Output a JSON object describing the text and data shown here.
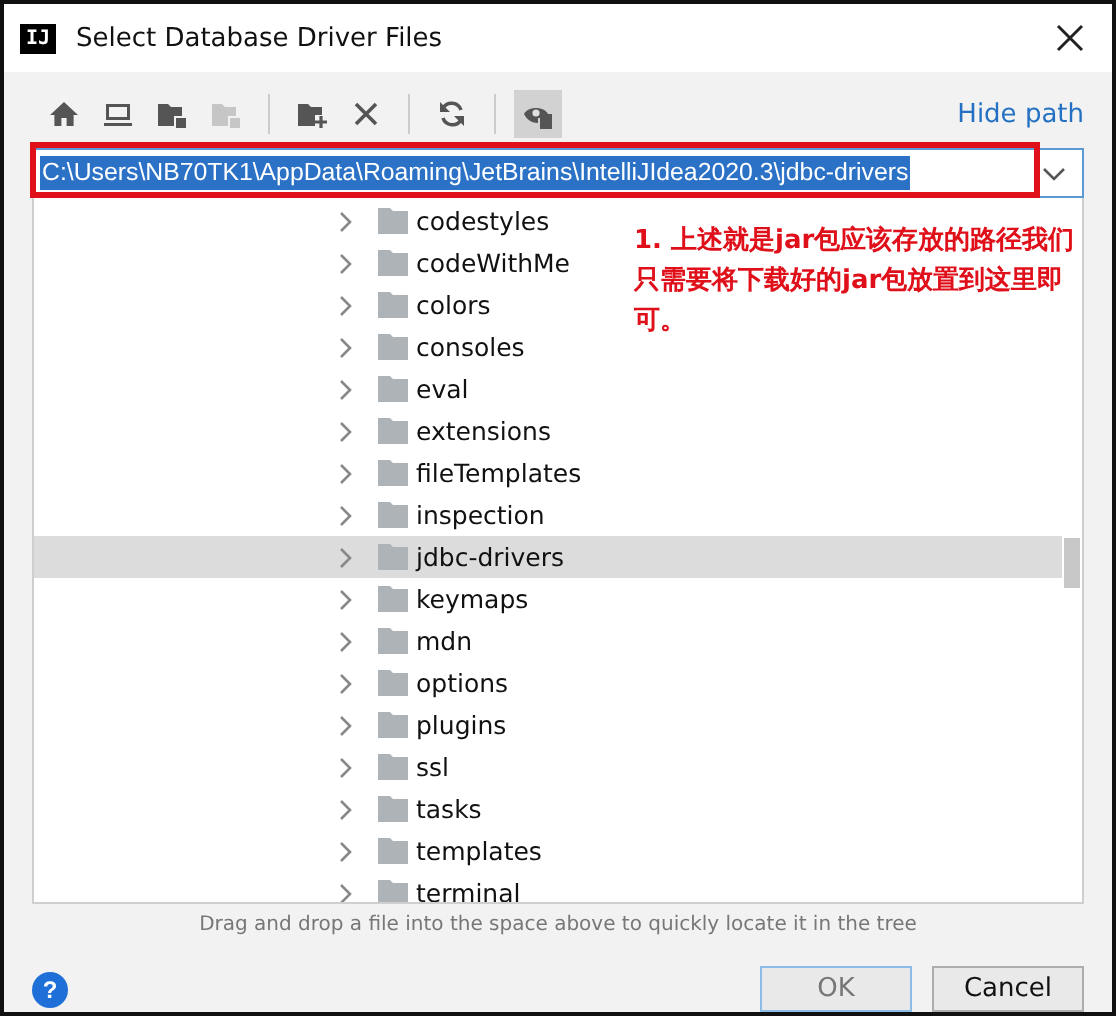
{
  "window": {
    "title": "Select Database Driver Files",
    "app_badge": "IJ"
  },
  "toolbar": [
    {
      "kind": "home",
      "disabled": false,
      "on": false
    },
    {
      "kind": "desktop",
      "disabled": false,
      "on": false
    },
    {
      "kind": "project",
      "disabled": false,
      "on": false
    },
    {
      "kind": "module",
      "disabled": true,
      "on": false
    },
    {
      "kind": "sep"
    },
    {
      "kind": "newfolder",
      "disabled": false,
      "on": false
    },
    {
      "kind": "delete",
      "disabled": false,
      "on": false
    },
    {
      "kind": "sep"
    },
    {
      "kind": "refresh",
      "disabled": false,
      "on": false
    },
    {
      "kind": "sep"
    },
    {
      "kind": "hidden",
      "disabled": false,
      "on": true
    }
  ],
  "hide_path_link": "Hide path",
  "path_field": {
    "value": "C:\\Users\\NB70TK1\\AppData\\Roaming\\JetBrains\\IntelliJIdea2020.3\\jdbc-drivers"
  },
  "tree": {
    "items": [
      {
        "name": "codestyles",
        "selected": false
      },
      {
        "name": "codeWithMe",
        "selected": false
      },
      {
        "name": "colors",
        "selected": false
      },
      {
        "name": "consoles",
        "selected": false
      },
      {
        "name": "eval",
        "selected": false
      },
      {
        "name": "extensions",
        "selected": false
      },
      {
        "name": "fileTemplates",
        "selected": false
      },
      {
        "name": "inspection",
        "selected": false
      },
      {
        "name": "jdbc-drivers",
        "selected": true
      },
      {
        "name": "keymaps",
        "selected": false
      },
      {
        "name": "mdn",
        "selected": false
      },
      {
        "name": "options",
        "selected": false
      },
      {
        "name": "plugins",
        "selected": false
      },
      {
        "name": "ssl",
        "selected": false
      },
      {
        "name": "tasks",
        "selected": false
      },
      {
        "name": "templates",
        "selected": false
      },
      {
        "name": "terminal",
        "selected": false
      }
    ]
  },
  "annotation": "1. 上述就是jar包应该存放的路径我们只需要将下载好的jar包放置到这里即可。",
  "hint": "Drag and drop a file into the space above to quickly locate it in the tree",
  "help_button": "?",
  "buttons": [
    {
      "label": "OK",
      "disabled": true
    },
    {
      "label": "Cancel",
      "disabled": false
    }
  ]
}
